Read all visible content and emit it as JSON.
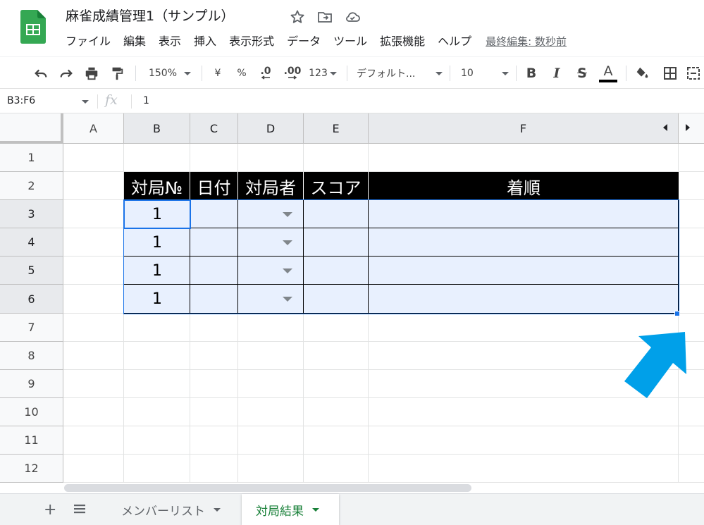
{
  "app": {
    "doc_title": "麻雀成績管理1（サンプル）",
    "last_edit": "最終編集: 数秒前",
    "icons": [
      "star-icon",
      "move-to-folder-icon",
      "cloud-saved-icon"
    ]
  },
  "menu": [
    "ファイル",
    "編集",
    "表示",
    "挿入",
    "表示形式",
    "データ",
    "ツール",
    "拡張機能",
    "ヘルプ"
  ],
  "toolbar": {
    "zoom": "150%",
    "currency": "¥",
    "percent": "%",
    "decrease_decimal": ".0",
    "increase_decimal": ".00",
    "more_formats": "123",
    "font": "デフォルト...",
    "font_size": "10",
    "bold": "B",
    "italic": "I",
    "strike": "S",
    "text_color": "A"
  },
  "formula_bar": {
    "name_box": "B3:F6",
    "fx": "fx",
    "value": "1"
  },
  "grid": {
    "columns": [
      "A",
      "B",
      "C",
      "D",
      "E",
      "F"
    ],
    "rows": [
      "1",
      "2",
      "3",
      "4",
      "5",
      "6",
      "7",
      "8",
      "9",
      "10",
      "11",
      "12"
    ],
    "table_headers": [
      "対局№",
      "日付",
      "対局者",
      "スコア",
      "着順"
    ],
    "b_values": [
      "1",
      "1",
      "1",
      "1"
    ]
  },
  "sheets": {
    "tabs": [
      "メンバーリスト",
      "対局結果"
    ],
    "active": "対局結果"
  },
  "colors": {
    "selection": "#e8f0fe",
    "accent": "#1a73e8",
    "header_black": "#000000",
    "arrow": "#00a0e9",
    "active_tab": "#188038"
  }
}
